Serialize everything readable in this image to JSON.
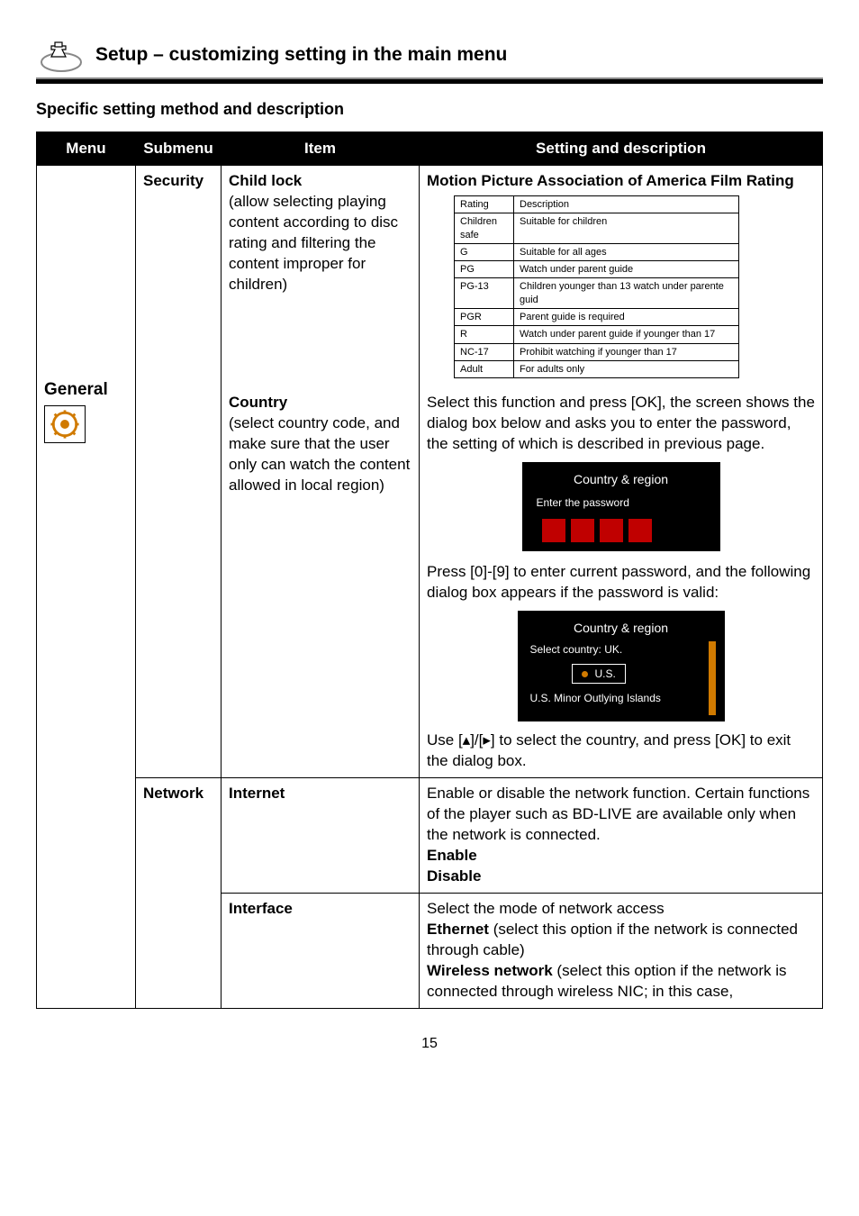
{
  "header": {
    "title": "Setup – customizing setting in the main menu"
  },
  "section_heading": "Specific setting method and description",
  "table": {
    "headers": {
      "menu": "Menu",
      "submenu": "Submenu",
      "item": "Item",
      "setting": "Setting and description"
    },
    "menu_label": "General",
    "security": {
      "label": "Security",
      "child_lock": {
        "title": "Child lock",
        "desc": "(allow selecting playing content according to disc rating and filtering the content improper for children)",
        "setting_title": "Motion Picture Association of America Film Rating",
        "headers": {
          "rating": "Rating",
          "description": "Description"
        },
        "rows": [
          {
            "rating": "Children safe",
            "desc": "Suitable for children"
          },
          {
            "rating": "G",
            "desc": "Suitable for all ages"
          },
          {
            "rating": "PG",
            "desc": "Watch under parent guide"
          },
          {
            "rating": "PG-13",
            "desc": "Children younger than 13 watch under parente guid"
          },
          {
            "rating": "PGR",
            "desc": "Parent guide is required"
          },
          {
            "rating": "R",
            "desc": "Watch under parent guide if younger than 17"
          },
          {
            "rating": "NC-17",
            "desc": "Prohibit watching if younger than 17"
          },
          {
            "rating": "Adult",
            "desc": "For adults only"
          }
        ]
      },
      "country": {
        "title": "Country",
        "desc": "(select country code, and make sure that the user only can watch the content allowed in local region)",
        "para1": "Select this function and press [OK], the screen shows the dialog box below and asks you to enter the password, the setting of which is described in previous page.",
        "box1_title": "Country & region",
        "box1_sub": "Enter the password",
        "para2": "Press [0]-[9] to enter current password, and the following dialog box appears if the password is valid:",
        "box2_title": "Country & region",
        "box2_line1": "Select country: UK.",
        "box2_us": "U.S.",
        "box2_line3": "U.S. Minor Outlying Islands",
        "para3": "Use [▴]/[▸] to select the country, and press [OK] to exit the dialog box."
      }
    },
    "network": {
      "label": "Network",
      "internet": {
        "title": "Internet",
        "desc": "Enable or disable the network function. Certain functions of the player such as BD-LIVE are available only when the network is connected.",
        "enable": "Enable",
        "disable": "Disable"
      },
      "interface": {
        "title": "Interface",
        "line1": "Select the mode of network access",
        "eth_label": "Ethernet",
        "eth_desc": " (select this option if the network is connected through cable)",
        "wifi_label": "Wireless network",
        "wifi_desc": " (select this option if the network is connected through wireless NIC; in this case,"
      }
    }
  },
  "page_number": "15"
}
